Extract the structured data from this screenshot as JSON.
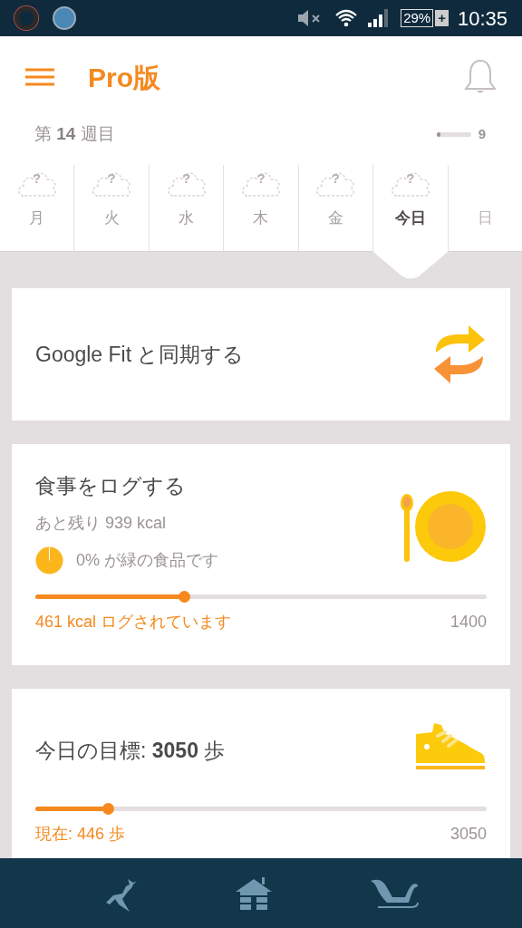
{
  "status_bar": {
    "battery": "29%",
    "charging": "+",
    "time": "10:35"
  },
  "header": {
    "title": "Pro版"
  },
  "week": {
    "label_prefix": "第",
    "number": "14",
    "label_suffix": "週目",
    "level": 0.12,
    "count": "9"
  },
  "days": [
    {
      "label": "月",
      "weather": "?",
      "selected": false,
      "disabled": false
    },
    {
      "label": "火",
      "weather": "?",
      "selected": false,
      "disabled": false
    },
    {
      "label": "水",
      "weather": "?",
      "selected": false,
      "disabled": false
    },
    {
      "label": "木",
      "weather": "?",
      "selected": false,
      "disabled": false
    },
    {
      "label": "金",
      "weather": "?",
      "selected": false,
      "disabled": false
    },
    {
      "label": "今日",
      "weather": "?",
      "selected": true,
      "disabled": false
    },
    {
      "label": "日",
      "selected": false,
      "disabled": true
    }
  ],
  "cards": [
    {
      "kind": "sync",
      "title": "Google Fit と同期する"
    },
    {
      "kind": "food",
      "title": "食事をログする",
      "remaining": "あと残り 939 kcal",
      "green": "0% が緑の食品です",
      "level": 0.33,
      "progress": "461 kcal ログされています",
      "goal": "1400"
    },
    {
      "kind": "steps",
      "title": "今日の目標: **3050** 歩",
      "level": 0.16,
      "progress": "現在: 446 歩",
      "goal": "3050"
    }
  ]
}
